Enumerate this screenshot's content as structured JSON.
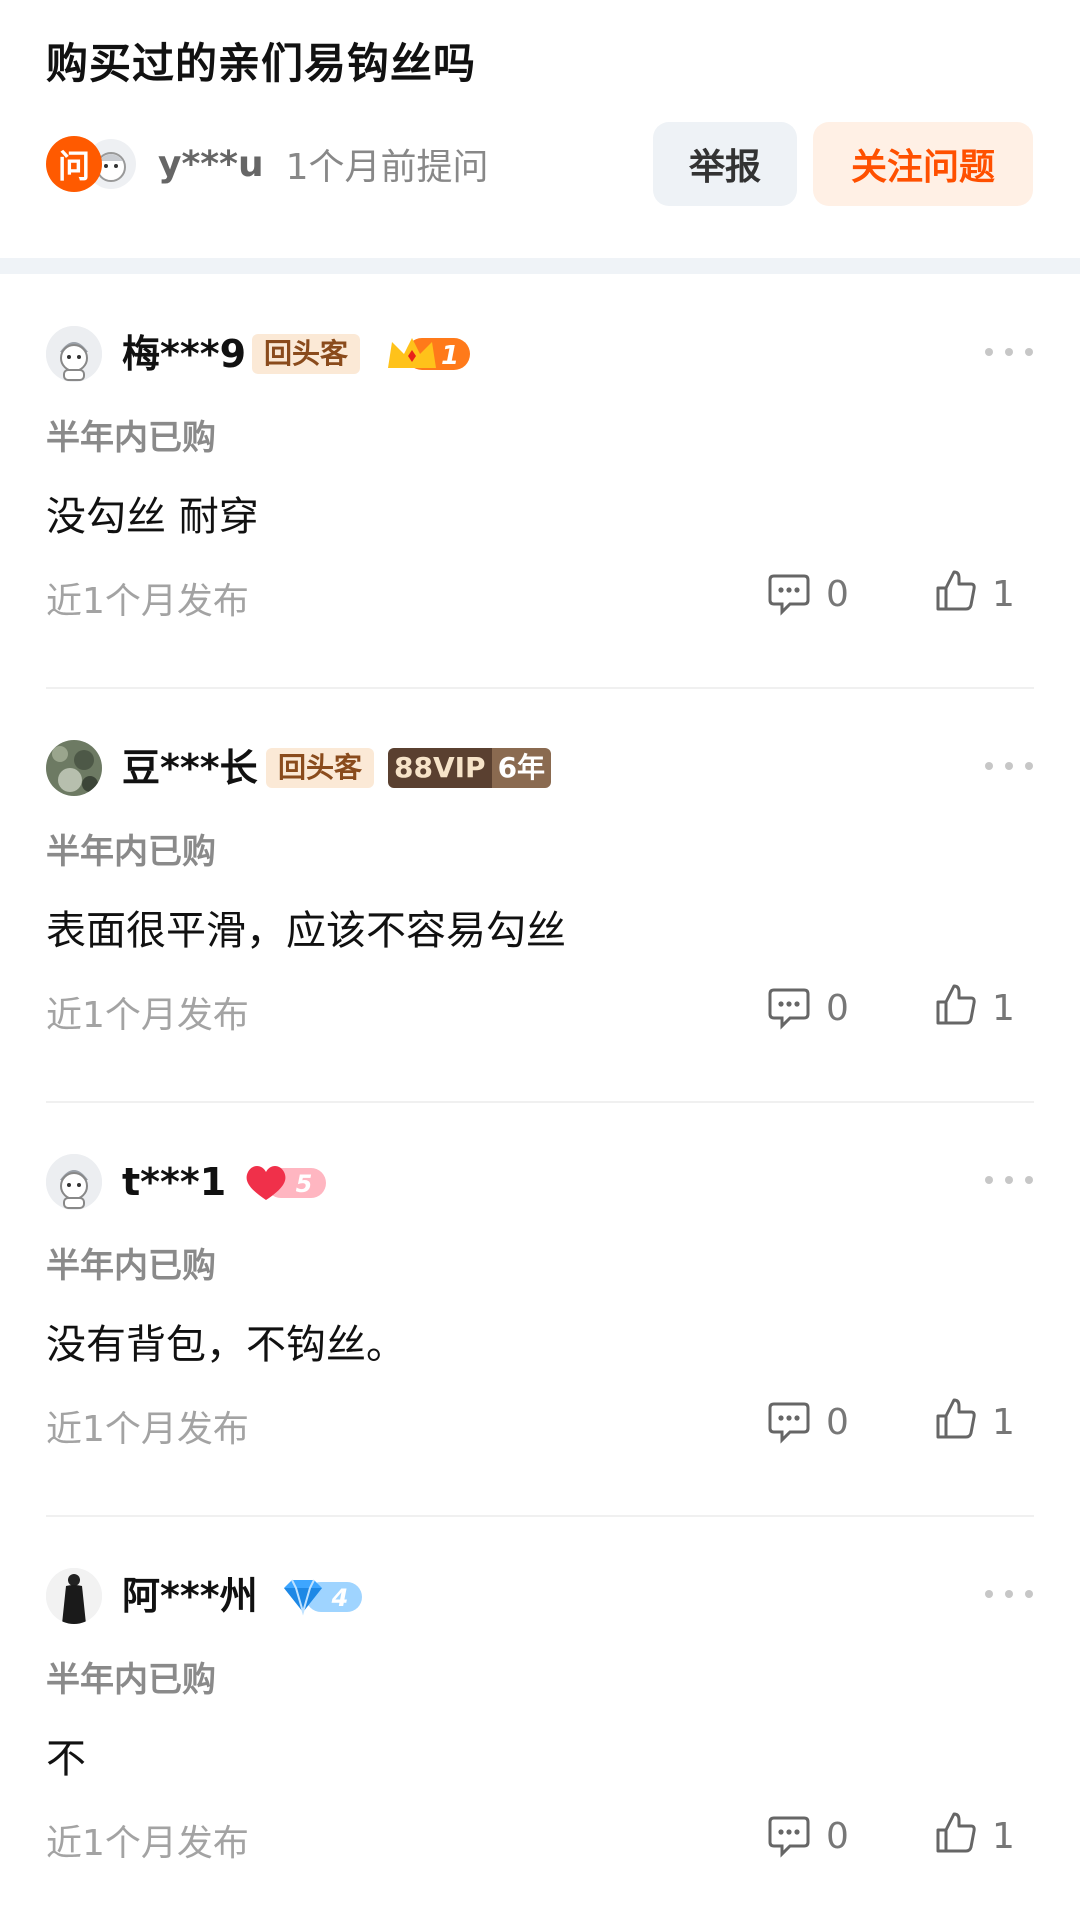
{
  "question": {
    "title": "购买过的亲们易钩丝吗",
    "asker_badge": "问",
    "asker_name": "y***u",
    "asker_time": "1个月前提问",
    "report_label": "举报",
    "follow_label": "关注问题"
  },
  "reviews": [
    {
      "username": "梅***9",
      "tag": "回头客",
      "level_badge": "1",
      "bought": "半年内已购",
      "content": "没勾丝 耐穿",
      "posted": "近1个月发布",
      "comments": "0",
      "likes": "1"
    },
    {
      "username": "豆***长",
      "tag": "回头客",
      "vip_label": "88VIP",
      "vip_years": "6年",
      "bought": "半年内已购",
      "content": "表面很平滑，应该不容易勾丝",
      "posted": "近1个月发布",
      "comments": "0",
      "likes": "1"
    },
    {
      "username": "t***1",
      "level_badge": "5",
      "bought": "半年内已购",
      "content": "没有背包，不钩丝。",
      "posted": "近1个月发布",
      "comments": "0",
      "likes": "1"
    },
    {
      "username": "阿***州",
      "level_badge": "4",
      "bought": "半年内已购",
      "content": "不",
      "posted": "近1个月发布",
      "comments": "0",
      "likes": "1"
    }
  ],
  "colors": {
    "accent": "#ff5000",
    "tag_bg": "#fbe9d6",
    "muted": "#a3a3a3"
  }
}
